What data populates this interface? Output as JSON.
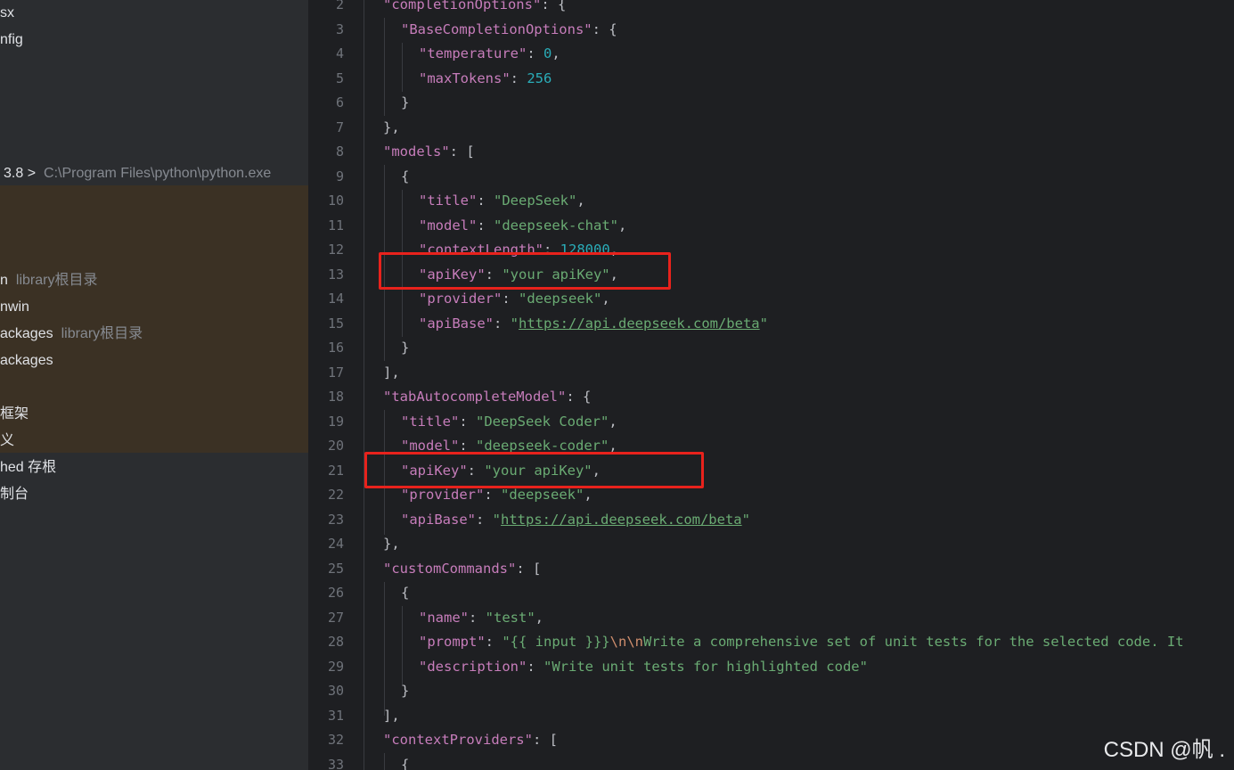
{
  "sidebar": {
    "items": [
      {
        "text": "sx",
        "dim": ""
      },
      {
        "text": "nfig",
        "dim": ""
      },
      {
        "text": "3.8 >",
        "dim": "C:\\Program Files\\python\\python.exe"
      },
      {
        "text": "n",
        "dim": "library根目录"
      },
      {
        "text": "nwin",
        "dim": ""
      },
      {
        "text": "ackages",
        "dim": "library根目录"
      },
      {
        "text": "ackages",
        "dim": ""
      },
      {
        "text": "框架",
        "dim": ""
      },
      {
        "text": "义",
        "dim": ""
      },
      {
        "text": "hed 存根",
        "dim": ""
      },
      {
        "text": "制台",
        "dim": ""
      }
    ]
  },
  "editor": {
    "lines": [
      {
        "num": "2",
        "tokens": [
          [
            "k",
            "\"completionOptions\""
          ],
          [
            "p",
            ": {"
          ]
        ]
      },
      {
        "num": "3",
        "tokens": [
          [
            "k",
            "\"BaseCompletionOptions\""
          ],
          [
            "p",
            ": {"
          ]
        ]
      },
      {
        "num": "4",
        "tokens": [
          [
            "k",
            "\"temperature\""
          ],
          [
            "p",
            ": "
          ],
          [
            "n",
            "0"
          ],
          [
            "p",
            ","
          ]
        ]
      },
      {
        "num": "5",
        "tokens": [
          [
            "k",
            "\"maxTokens\""
          ],
          [
            "p",
            ": "
          ],
          [
            "n",
            "256"
          ]
        ]
      },
      {
        "num": "6",
        "tokens": [
          [
            "p",
            "}"
          ]
        ]
      },
      {
        "num": "7",
        "tokens": [
          [
            "p",
            "},"
          ]
        ]
      },
      {
        "num": "8",
        "tokens": [
          [
            "k",
            "\"models\""
          ],
          [
            "p",
            ": ["
          ]
        ]
      },
      {
        "num": "9",
        "tokens": [
          [
            "p",
            "{"
          ]
        ]
      },
      {
        "num": "10",
        "tokens": [
          [
            "k",
            "\"title\""
          ],
          [
            "p",
            ": "
          ],
          [
            "s",
            "\"DeepSeek\""
          ],
          [
            "p",
            ","
          ]
        ]
      },
      {
        "num": "11",
        "tokens": [
          [
            "k",
            "\"model\""
          ],
          [
            "p",
            ": "
          ],
          [
            "s",
            "\"deepseek-chat\""
          ],
          [
            "p",
            ","
          ]
        ]
      },
      {
        "num": "12",
        "tokens": [
          [
            "k",
            "\"contextLength\""
          ],
          [
            "p",
            ": "
          ],
          [
            "n",
            "128000"
          ],
          [
            "p",
            ","
          ]
        ]
      },
      {
        "num": "13",
        "tokens": [
          [
            "k",
            "\"apiKey\""
          ],
          [
            "p",
            ": "
          ],
          [
            "s",
            "\"your apiKey\""
          ],
          [
            "p",
            ","
          ]
        ]
      },
      {
        "num": "14",
        "tokens": [
          [
            "k",
            "\"provider\""
          ],
          [
            "p",
            ": "
          ],
          [
            "s",
            "\"deepseek\""
          ],
          [
            "p",
            ","
          ]
        ]
      },
      {
        "num": "15",
        "tokens": [
          [
            "k",
            "\"apiBase\""
          ],
          [
            "p",
            ": "
          ],
          [
            "s",
            "\""
          ],
          [
            "u",
            "https://api.deepseek.com/beta"
          ],
          [
            "s",
            "\""
          ]
        ]
      },
      {
        "num": "16",
        "tokens": [
          [
            "p",
            "}"
          ]
        ]
      },
      {
        "num": "17",
        "tokens": [
          [
            "p",
            "],"
          ]
        ]
      },
      {
        "num": "18",
        "tokens": [
          [
            "k",
            "\"tabAutocompleteModel\""
          ],
          [
            "p",
            ": {"
          ]
        ]
      },
      {
        "num": "19",
        "tokens": [
          [
            "k",
            "\"title\""
          ],
          [
            "p",
            ": "
          ],
          [
            "s",
            "\"DeepSeek Coder\""
          ],
          [
            "p",
            ","
          ]
        ]
      },
      {
        "num": "20",
        "tokens": [
          [
            "k",
            "\"model\""
          ],
          [
            "p",
            ": "
          ],
          [
            "s",
            "\"deepseek-coder\""
          ],
          [
            "p",
            ","
          ]
        ]
      },
      {
        "num": "21",
        "tokens": [
          [
            "k",
            "\"apiKey\""
          ],
          [
            "p",
            ": "
          ],
          [
            "s",
            "\"your apiKey\""
          ],
          [
            "p",
            ","
          ]
        ]
      },
      {
        "num": "22",
        "tokens": [
          [
            "k",
            "\"provider\""
          ],
          [
            "p",
            ": "
          ],
          [
            "s",
            "\"deepseek\""
          ],
          [
            "p",
            ","
          ]
        ]
      },
      {
        "num": "23",
        "tokens": [
          [
            "k",
            "\"apiBase\""
          ],
          [
            "p",
            ": "
          ],
          [
            "s",
            "\""
          ],
          [
            "u",
            "https://api.deepseek.com/beta"
          ],
          [
            "s",
            "\""
          ]
        ]
      },
      {
        "num": "24",
        "tokens": [
          [
            "p",
            "},"
          ]
        ]
      },
      {
        "num": "25",
        "tokens": [
          [
            "k",
            "\"customCommands\""
          ],
          [
            "p",
            ": ["
          ]
        ]
      },
      {
        "num": "26",
        "tokens": [
          [
            "p",
            "{"
          ]
        ]
      },
      {
        "num": "27",
        "tokens": [
          [
            "k",
            "\"name\""
          ],
          [
            "p",
            ": "
          ],
          [
            "s",
            "\"test\""
          ],
          [
            "p",
            ","
          ]
        ]
      },
      {
        "num": "28",
        "tokens": [
          [
            "k",
            "\"prompt\""
          ],
          [
            "p",
            ": "
          ],
          [
            "s",
            "\"{{ input }}}"
          ],
          [
            "e",
            "\\n\\n"
          ],
          [
            "s",
            "Write a comprehensive set of unit tests for the selected code. It"
          ]
        ]
      },
      {
        "num": "29",
        "tokens": [
          [
            "k",
            "\"description\""
          ],
          [
            "p",
            ": "
          ],
          [
            "s",
            "\"Write unit tests for highlighted code\""
          ]
        ]
      },
      {
        "num": "30",
        "tokens": [
          [
            "p",
            "}"
          ]
        ]
      },
      {
        "num": "31",
        "tokens": [
          [
            "p",
            "],"
          ]
        ]
      },
      {
        "num": "32",
        "tokens": [
          [
            "k",
            "\"contextProviders\""
          ],
          [
            "p",
            ": ["
          ]
        ]
      },
      {
        "num": "33",
        "tokens": [
          [
            "p",
            "{"
          ]
        ]
      }
    ]
  },
  "watermark": "CSDN @帆 ."
}
